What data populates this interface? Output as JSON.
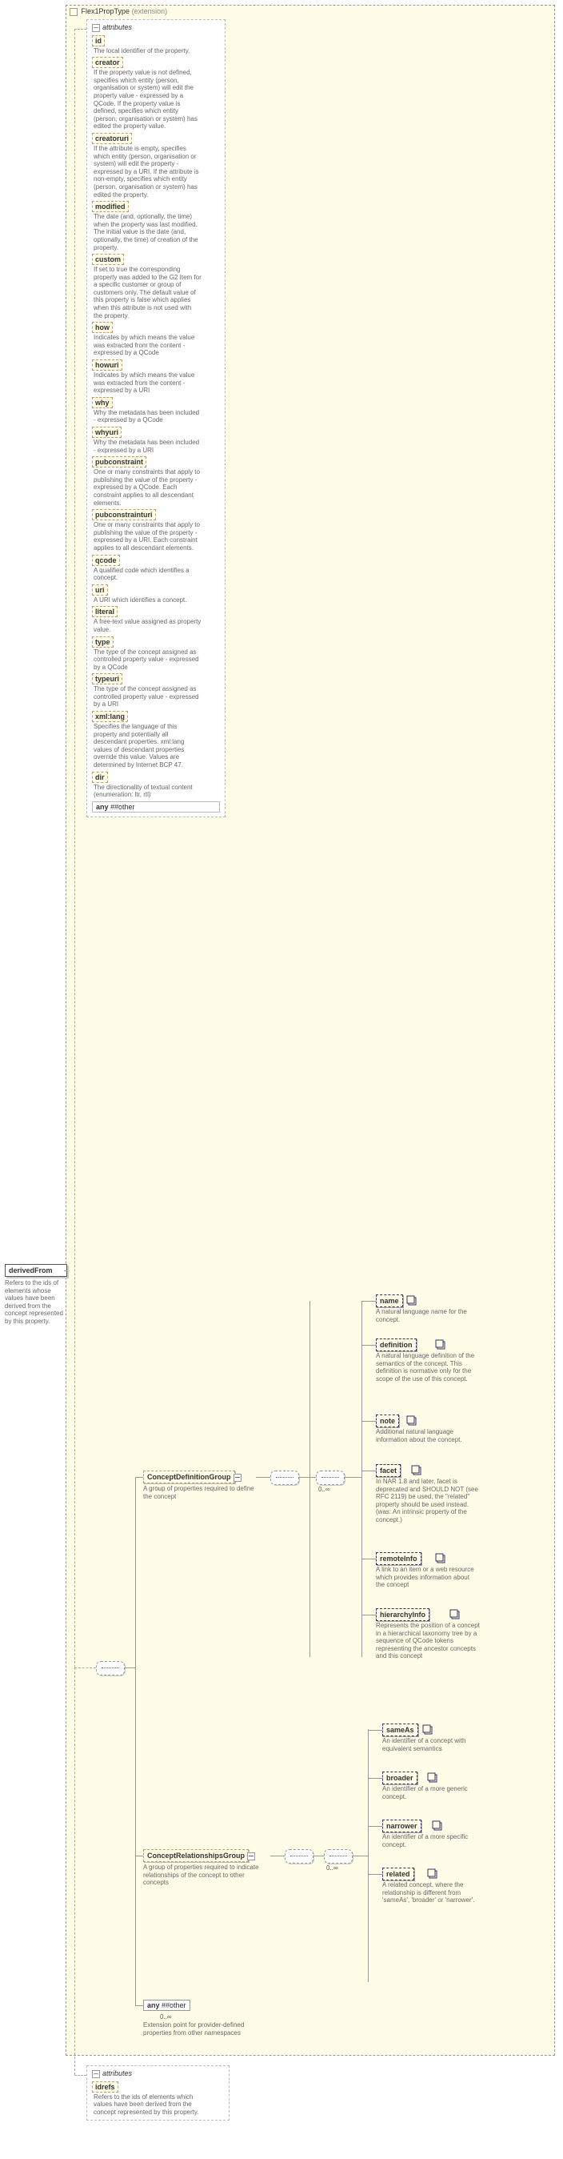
{
  "extension": {
    "name": "Flex1PropType",
    "suffix": "(extension)"
  },
  "root_element": {
    "name": "derivedFrom",
    "desc": "Refers to the ids of elements whose values have been derived from the concept represented by this property."
  },
  "attributes_label": "attributes",
  "main_attrs": [
    {
      "name": "id",
      "desc": "The local identifier of the property."
    },
    {
      "name": "creator",
      "desc": "If the property value is not defined, specifies which entity (person, organisation or system) will edit the property value - expressed by a QCode. If the property value is defined, specifies which entity (person, organisation or system) has edited the property value."
    },
    {
      "name": "creatoruri",
      "desc": "If the attribute is empty, specifies which entity (person, organisation or system) will edit the property - expressed by a URI. If the attribute is non-empty, specifies which entity (person, organisation or system) has edited the property."
    },
    {
      "name": "modified",
      "desc": "The date (and, optionally, the time) when the property was last modified. The initial value is the date (and, optionally, the time) of creation of the property."
    },
    {
      "name": "custom",
      "desc": "If set to true the corresponding property was added to the G2 Item for a specific customer or group of customers only. The default value of this property is false which applies when this attribute is not used with the property."
    },
    {
      "name": "how",
      "desc": "Indicates by which means the value was extracted from the content - expressed by a QCode"
    },
    {
      "name": "howuri",
      "desc": "Indicates by which means the value was extracted from the content - expressed by a URI"
    },
    {
      "name": "why",
      "desc": "Why the metadata has been included - expressed by a QCode"
    },
    {
      "name": "whyuri",
      "desc": "Why the metadata has been included - expressed by a URI"
    },
    {
      "name": "pubconstraint",
      "desc": "One or many constraints that apply to publishing the value of the property - expressed by a QCode. Each constraint applies to all descendant elements."
    },
    {
      "name": "pubconstrainturi",
      "desc": "One or many constraints that apply to publishing the value of the property - expressed by a URI. Each constraint applies to all descendant elements."
    },
    {
      "name": "qcode",
      "desc": "A qualified code which identifies a concept."
    },
    {
      "name": "uri",
      "desc": "A URI which identifies a concept."
    },
    {
      "name": "literal",
      "desc": "A free-text value assigned as property value."
    },
    {
      "name": "type",
      "desc": "The type of the concept assigned as controlled property value - expressed by a QCode"
    },
    {
      "name": "typeuri",
      "desc": "The type of the concept assigned as controlled property value - expressed by a URI"
    },
    {
      "name": "xml:lang",
      "desc": "Specifies the language of this property and potentially all descendant properties. xml:lang values of descendant properties override this value. Values are determined by Internet BCP 47."
    },
    {
      "name": "dir",
      "desc": "The directionality of textual content (enumeration: ltr, rtl)"
    }
  ],
  "attr_any": {
    "kw": "any",
    "pattern": "##other"
  },
  "bottom_attr": {
    "name": "idrefs",
    "desc": "Refers to the ids of elements which  values have been derived from the concept represented by this property."
  },
  "groups": {
    "defGroup": {
      "name": "ConceptDefinitionGroup",
      "desc": "A group of properties required to define the concept"
    },
    "relGroup": {
      "name": "ConceptRelationshipsGroup",
      "desc": "A group of properties required to indicate relationships of the concept to other concepts"
    }
  },
  "def_children": [
    {
      "name": "name",
      "multi": true,
      "desc": "A natural language name for the concept."
    },
    {
      "name": "definition",
      "multi": true,
      "desc": "A natural language definition of the semantics of the concept. This definition is normative only for the scope of the use of this concept."
    },
    {
      "name": "note",
      "multi": true,
      "desc": "Additional natural language information about the concept."
    },
    {
      "name": "facet",
      "multi": true,
      "desc": "In NAR 1.8 and later, facet is deprecated and SHOULD NOT (see RFC 2119) be used, the \"related\" property should be used instead.(was: An intrinsic property of the concept.)"
    },
    {
      "name": "remoteInfo",
      "multi": true,
      "desc": "A link to an item or a web resource which provides information about the concept"
    },
    {
      "name": "hierarchyInfo",
      "multi": true,
      "desc": "Represents the position of a concept in a hierarchical taxonomy tree by a sequence of QCode tokens representing the ancestor concepts and this concept"
    }
  ],
  "rel_children": [
    {
      "name": "sameAs",
      "multi": true,
      "desc": "An identifier of a concept with equivalent semantics"
    },
    {
      "name": "broader",
      "multi": true,
      "desc": "An identifier of a more generic concept."
    },
    {
      "name": "narrower",
      "multi": true,
      "desc": "An identifier of a more specific concept."
    },
    {
      "name": "related",
      "multi": true,
      "desc": "A related concept, where the relationship is different from 'sameAs', 'broader' or 'narrower'."
    }
  ],
  "other_any": {
    "kw": "any",
    "pattern": "##other",
    "occ": "0..∞",
    "desc": "Extension point for provider-defined properties from other namespaces"
  },
  "occ_inf": "0..∞"
}
